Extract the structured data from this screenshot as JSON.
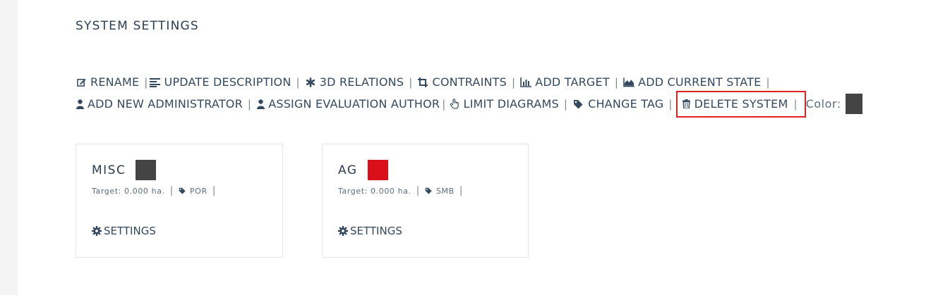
{
  "page": {
    "title": "SYSTEM SETTINGS"
  },
  "actions": {
    "row1": [
      {
        "label": "RENAME",
        "icon": "edit-icon"
      },
      {
        "label": "UPDATE DESCRIPTION",
        "icon": "align-left-icon"
      },
      {
        "label": "3D RELATIONS",
        "icon": "asterisk-icon"
      },
      {
        "label": "CONTRAINTS",
        "icon": "crop-icon"
      },
      {
        "label": "ADD TARGET",
        "icon": "bar-chart-icon"
      },
      {
        "label": "ADD CURRENT STATE",
        "icon": "area-chart-icon"
      }
    ],
    "row2": [
      {
        "label": "ADD NEW ADMINISTRATOR",
        "icon": "user-icon"
      },
      {
        "label": "ASSIGN EVALUATION AUTHOR",
        "icon": "user-icon"
      },
      {
        "label": "LIMIT DIAGRAMS",
        "icon": "hand-pointer-icon"
      },
      {
        "label": "CHANGE TAG",
        "icon": "tag-icon"
      },
      {
        "label": "DELETE SYSTEM",
        "icon": "trash-icon"
      }
    ],
    "color_label": "Color:",
    "color_value": "#444444",
    "highlight_color": "#e0201c"
  },
  "cards": [
    {
      "name": "MISC",
      "color": "#444444",
      "target": "Target: 0.000 ha.",
      "tag": "POR",
      "settings_label": "SETTINGS"
    },
    {
      "name": "AG",
      "color": "#d9101a",
      "target": "Target: 0.000 ha.",
      "tag": "SMB",
      "settings_label": "SETTINGS"
    }
  ]
}
